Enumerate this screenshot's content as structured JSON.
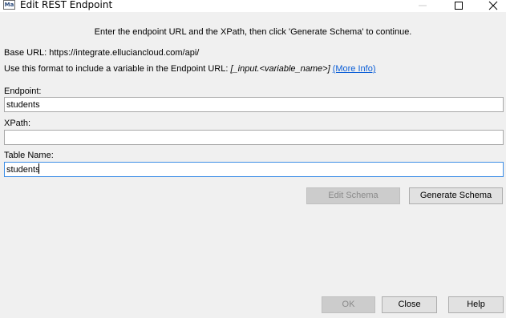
{
  "window": {
    "app_icon_text": "Ma",
    "title": "Edit REST Endpoint",
    "controls": [
      "minimize-icon",
      "maximize-icon",
      "close-icon"
    ]
  },
  "instruction": "Enter the endpoint URL and the XPath, then click 'Generate Schema' to continue.",
  "base_url": {
    "text": "Base URL: https://integrate.elluciancloud.com/api/"
  },
  "hint": {
    "prefix": "Use this format to include a variable in the Endpoint URL: ",
    "format": "[_input.<variable_name>]",
    "link": "(More Info)"
  },
  "fields": {
    "endpoint": {
      "label": "Endpoint:",
      "value": "students"
    },
    "xpath": {
      "label": "XPath:",
      "value": ""
    },
    "table_name": {
      "label": "Table Name:",
      "value": "students"
    }
  },
  "buttons": {
    "edit_schema": "Edit Schema",
    "generate_schema": "Generate Schema",
    "ok": "OK",
    "close": "Close",
    "help": "Help"
  },
  "colors": {
    "link": "#0b5ed7",
    "focus_border": "#3d8ee6",
    "dialog_bg": "#f0f0f0"
  }
}
